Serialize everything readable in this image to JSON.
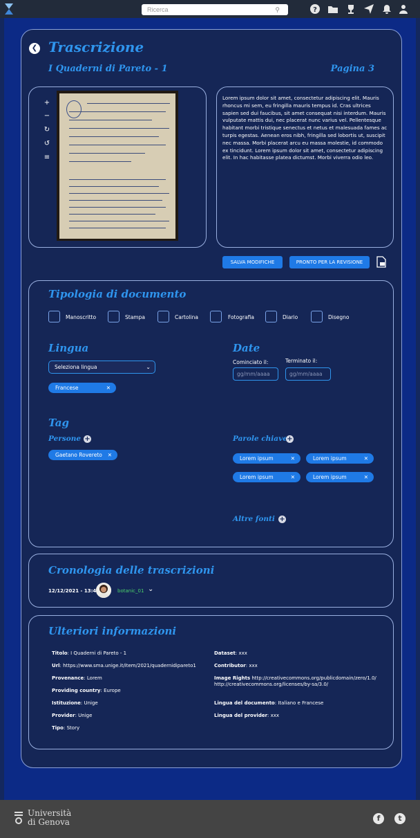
{
  "search": {
    "placeholder": "Ricerca"
  },
  "topbar": {
    "icons": [
      "help-icon",
      "folder-icon",
      "trophy-icon",
      "send-icon",
      "bell-icon",
      "user-icon"
    ]
  },
  "page": {
    "title": "Trascrizione",
    "document_title": "I Quaderni di Pareto - 1",
    "page_label": "Pagina 3"
  },
  "viewer": {
    "tools": [
      "zoom-in-icon",
      "zoom-out-icon",
      "rotate-right-icon",
      "rotate-left-icon",
      "adjust-icon"
    ]
  },
  "transcription": {
    "text": "Lorem ipsum dolor sit amet, consectetur adipiscing elit. Mauris rhoncus mi sem, eu fringilla mauris tempus id. Cras ultrices sapien sed dui faucibus, sit amet consequat nisi interdum. Mauris vulputate mattis dui, nec placerat nunc varius vel. Pellentesque habitant morbi tristique senectus et netus et malesuada fames ac turpis egestas. Aenean eros nibh, fringilla sed lobortis ut, suscipit nec massa. Morbi placerat arcu eu massa molestie, id commodo ex tincidunt. Lorem ipsum dolor sit amet, consectetur adipiscing elit. In hac habitasse platea dictumst. Morbi viverra odio leo."
  },
  "actions": {
    "save": "SALVA MODIFICHE",
    "ready": "PRONTO PER LA REVISIONE"
  },
  "tipologia": {
    "title": "Tipologia di documento",
    "options": [
      "Manoscritto",
      "Stampa",
      "Cartolina",
      "Fotografia",
      "Diario",
      "Disegno"
    ]
  },
  "lingua": {
    "title": "Lingua",
    "select": "Seleziona lingua",
    "chip": "Francese"
  },
  "date": {
    "title": "Date",
    "start_label": "Cominciato il:",
    "end_label": "Terminato il:",
    "placeholder": "gg/mm/aaaa"
  },
  "tag": {
    "title": "Tag",
    "persone": "Persone",
    "persone_chips": [
      "Gaetano Rovereto"
    ],
    "parole": "Parole chiave",
    "parole_chips": [
      "Lorem ipsum",
      "Lorem ipsum",
      "Lorem ipsum",
      "Lorem ipsum"
    ],
    "altre": "Altre fonti"
  },
  "cronologia": {
    "title": "Cronologia delle trascrizioni",
    "date": "12/12/2021 - 13:45",
    "user": "botanic_01"
  },
  "info": {
    "title": "Ulteriori informazioni",
    "left": [
      {
        "k": "Titolo",
        "v": "I Quaderni di Pareto - 1"
      },
      {
        "k": "Url",
        "v": "https://www.sma.unige.it/item/2021/quadernidipareto1"
      },
      {
        "k": "Provenance",
        "v": "Lorem"
      },
      {
        "k": "Providing country",
        "v": "Europe"
      },
      {
        "k": "Istituzione",
        "v": "Unige"
      },
      {
        "k": "Provider",
        "v": "Unige"
      },
      {
        "k": "Tipo",
        "v": "Story"
      }
    ],
    "right": [
      {
        "k": "Dataset",
        "v": "xxx"
      },
      {
        "k": "Contributor",
        "v": "xxx"
      },
      {
        "k": "Image Rights",
        "v": "http://creativecommons.org/publicdomain/zero/1.0/ http://creativecommons.org/licenses/by-sa/3.0/"
      },
      {
        "k": "Lingua del documento",
        "v": "Italiano e Francese"
      },
      {
        "k": "Lingua del provider",
        "v": "xxx"
      }
    ]
  },
  "footer": {
    "university_line1": "Università",
    "university_line2": "di Genova",
    "social": [
      "facebook-icon",
      "twitter-icon"
    ]
  }
}
